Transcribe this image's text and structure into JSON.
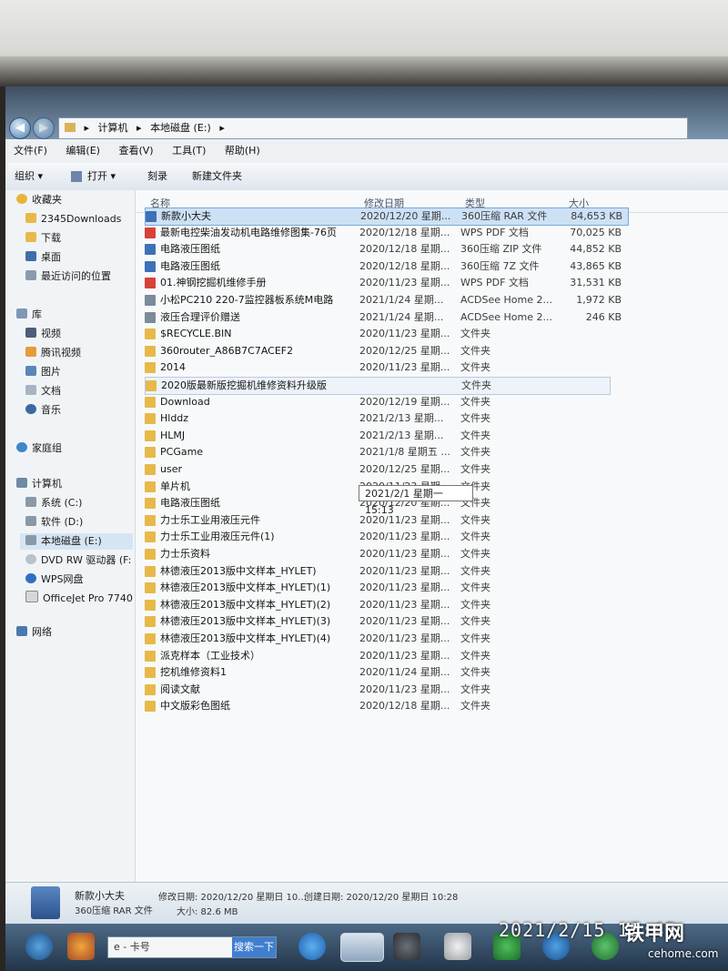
{
  "address": {
    "crumbs": [
      "计算机",
      "本地磁盘 (E:)"
    ]
  },
  "menu": [
    "文件(F)",
    "编辑(E)",
    "查看(V)",
    "工具(T)",
    "帮助(H)"
  ],
  "toolbar": {
    "organize": "组织 ▾",
    "open": "打开 ▾",
    "burn": "刻录",
    "new_folder": "新建文件夹"
  },
  "nav": {
    "favorites": "收藏夹",
    "fav_items": [
      "2345Downloads",
      "下载",
      "桌面",
      "最近访问的位置"
    ],
    "library": "库",
    "lib_items": [
      "视频",
      "腾讯视频",
      "图片",
      "文档",
      "音乐"
    ],
    "homegroup": "家庭组",
    "computer": "计算机",
    "comp_items": [
      "系统 (C:)",
      "软件 (D:)",
      "本地磁盘 (E:)",
      "DVD RW 驱动器 (F:",
      "WPS网盘",
      "OfficeJet Pro 7740"
    ],
    "network": "网络"
  },
  "columns": {
    "name": "名称",
    "date": "修改日期",
    "type": "类型",
    "size": "大小"
  },
  "files": [
    {
      "name": "新款小大夫",
      "date": "2020/12/20 星期...",
      "type": "360压缩 RAR 文件",
      "size": "84,653 KB"
    },
    {
      "name": "最新电控柴油发动机电路维修图集-76页",
      "date": "2020/12/18 星期...",
      "type": "WPS PDF 文档",
      "size": "70,025 KB"
    },
    {
      "name": "电路液压图纸",
      "date": "2020/12/18 星期...",
      "type": "360压缩 ZIP 文件",
      "size": "44,852 KB"
    },
    {
      "name": "电路液压图纸",
      "date": "2020/12/18 星期...",
      "type": "360压缩 7Z 文件",
      "size": "43,865 KB"
    },
    {
      "name": "01.神钢挖掘机维修手册",
      "date": "2020/11/23 星期...",
      "type": "WPS PDF 文档",
      "size": "31,531 KB"
    },
    {
      "name": "小松PC210 220-7监控器板系统M电路",
      "date": "2021/1/24 星期...",
      "type": "ACDSee Home 2...",
      "size": "1,972 KB"
    },
    {
      "name": "液压合理评价赠送",
      "date": "2021/1/24 星期...",
      "type": "ACDSee Home 2...",
      "size": "246 KB"
    },
    {
      "name": "$RECYCLE.BIN",
      "date": "2020/11/23 星期...",
      "type": "文件夹",
      "size": ""
    },
    {
      "name": "360router_A86B7C7ACEF2",
      "date": "2020/12/25 星期...",
      "type": "文件夹",
      "size": ""
    },
    {
      "name": "2014",
      "date": "2020/11/23 星期...",
      "type": "文件夹",
      "size": ""
    },
    {
      "name": "2020版最新版挖掘机维修资料升级版",
      "date": "",
      "type": "文件夹",
      "size": ""
    },
    {
      "name": "Download",
      "date": "2020/12/19 星期...",
      "type": "文件夹",
      "size": ""
    },
    {
      "name": "Hlddz",
      "date": "2021/2/13 星期...",
      "type": "文件夹",
      "size": ""
    },
    {
      "name": "HLMJ",
      "date": "2021/2/13 星期...",
      "type": "文件夹",
      "size": ""
    },
    {
      "name": "PCGame",
      "date": "2021/1/8 星期五 ...",
      "type": "文件夹",
      "size": ""
    },
    {
      "name": "user",
      "date": "2020/12/25 星期...",
      "type": "文件夹",
      "size": ""
    },
    {
      "name": "单片机",
      "date": "2020/11/23 星期...",
      "type": "文件夹",
      "size": ""
    },
    {
      "name": "电路液压图纸",
      "date": "2020/12/20 星期...",
      "type": "文件夹",
      "size": ""
    },
    {
      "name": "力士乐工业用液压元件",
      "date": "2020/11/23 星期...",
      "type": "文件夹",
      "size": ""
    },
    {
      "name": "力士乐工业用液压元件(1)",
      "date": "2020/11/23 星期...",
      "type": "文件夹",
      "size": ""
    },
    {
      "name": "力士乐资料",
      "date": "2020/11/23 星期...",
      "type": "文件夹",
      "size": ""
    },
    {
      "name": "林德液压2013版中文样本_HYLET)",
      "date": "2020/11/23 星期...",
      "type": "文件夹",
      "size": ""
    },
    {
      "name": "林德液压2013版中文样本_HYLET)(1)",
      "date": "2020/11/23 星期...",
      "type": "文件夹",
      "size": ""
    },
    {
      "name": "林德液压2013版中文样本_HYLET)(2)",
      "date": "2020/11/23 星期...",
      "type": "文件夹",
      "size": ""
    },
    {
      "name": "林德液压2013版中文样本_HYLET)(3)",
      "date": "2020/11/23 星期...",
      "type": "文件夹",
      "size": ""
    },
    {
      "name": "林德液压2013版中文样本_HYLET)(4)",
      "date": "2020/11/23 星期...",
      "type": "文件夹",
      "size": ""
    },
    {
      "name": "派克样本（工业技术）",
      "date": "2020/11/23 星期...",
      "type": "文件夹",
      "size": ""
    },
    {
      "name": "挖机维修资料1",
      "date": "2020/11/24 星期...",
      "type": "文件夹",
      "size": ""
    },
    {
      "name": "阅读文献",
      "date": "2020/11/23 星期...",
      "type": "文件夹",
      "size": ""
    },
    {
      "name": "中文版彩色图纸",
      "date": "2020/12/18 星期...",
      "type": "文件夹",
      "size": ""
    }
  ],
  "tooltip": "2021/2/1 星期一 15:13",
  "status": {
    "name": "新款小大夫",
    "type": "360压缩 RAR 文件",
    "modified": "修改日期: 2020/12/20 星期日 10...",
    "created": "创建日期: 2020/12/20 星期日 10:28",
    "size": "大小: 82.6 MB"
  },
  "taskbar": {
    "search_text": "e - 卡号",
    "search_btn": "搜索一下"
  },
  "photo": {
    "timestamp": "2021/2/15 15:45",
    "watermark": "铁甲网",
    "watermark_url": "cehome.com"
  },
  "colors": {
    "folder": "#e7b94a",
    "pdf": "#d8403a",
    "rar": "#3e70b8",
    "acdsee": "#7a8b9a",
    "selection": "#cde1f5"
  }
}
